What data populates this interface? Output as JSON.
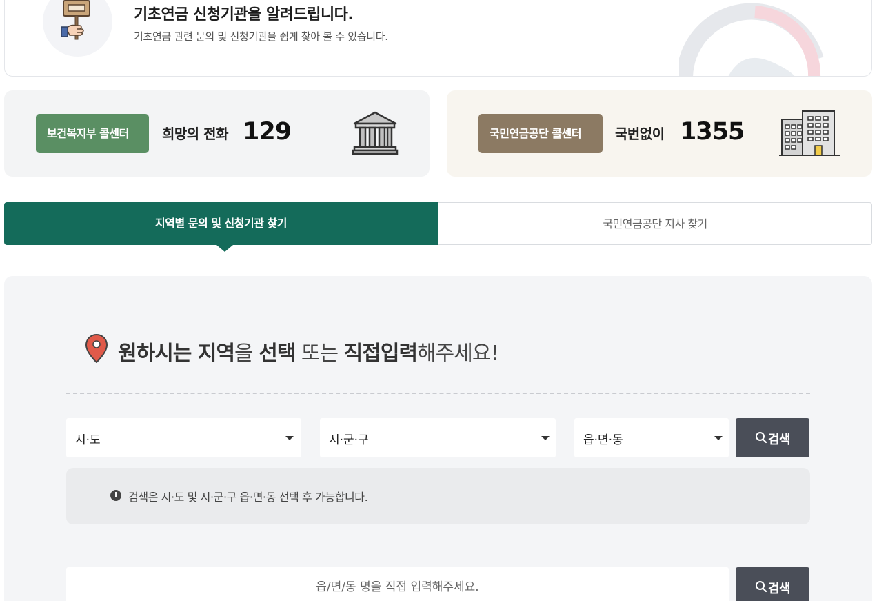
{
  "info": {
    "title": "기초연금 신청기관을 알려드립니다.",
    "subtitle": "기초연금 관련 문의 및 신청기관을 쉽게 찾아 볼 수 있습니다."
  },
  "call_centers": [
    {
      "badge": "보건복지부 콜센터",
      "name": "희망의 전화",
      "number": "129",
      "color": "#5a8f63",
      "icon": "government-building-icon"
    },
    {
      "badge": "국민연금공단 콜센터",
      "name": "국번없이",
      "number": "1355",
      "color": "#8c7a63",
      "icon": "office-building-icon"
    }
  ],
  "tabs": [
    {
      "label": "지역별 문의 및 신청기관 찾기",
      "active": true
    },
    {
      "label": "국민연금공단 지사 찾기",
      "active": false
    }
  ],
  "search": {
    "headline_parts": [
      "원하시는 지역",
      "을 ",
      "선택",
      " 또는 ",
      "직접입력",
      "해주세요!"
    ],
    "selects": [
      "시·도",
      "시·군·구",
      "읍·면·동"
    ],
    "button_label": "검색",
    "notice": "검색은 시·도 및 시·군·구 읍·면·동 선택 후 가능합니다.",
    "direct_placeholder": "읍/면/동 명을 직접 입력해주세요."
  },
  "colors": {
    "tab_active": "#146b5a",
    "button": "#4a4e58",
    "pin": "#e05a4a"
  }
}
